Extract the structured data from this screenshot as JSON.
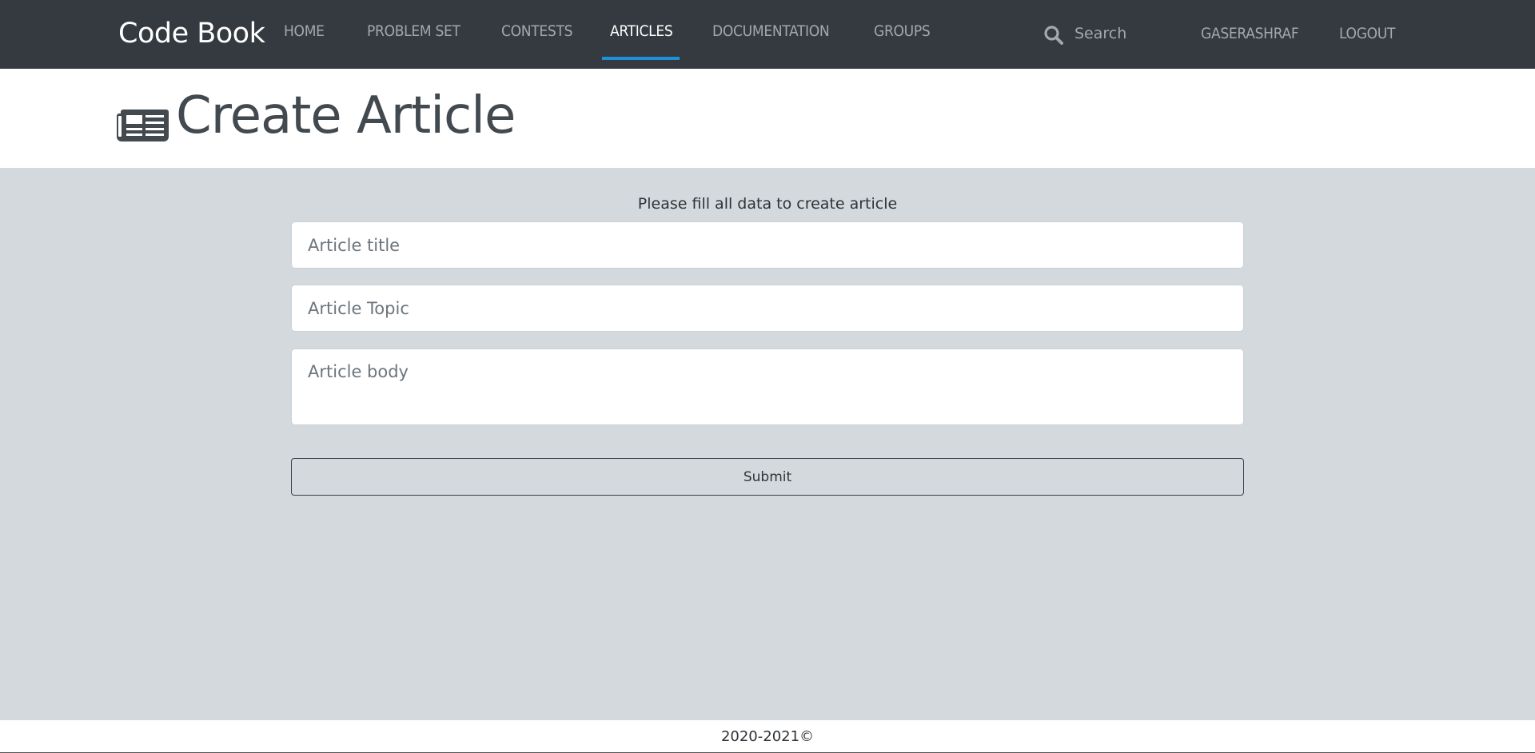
{
  "navbar": {
    "brand": "Code Book",
    "items": [
      {
        "label": "HOME",
        "active": false
      },
      {
        "label": "PROBLEM SET",
        "active": false
      },
      {
        "label": "CONTESTS",
        "active": false
      },
      {
        "label": "ARTICLES",
        "active": true
      },
      {
        "label": "DOCUMENTATION",
        "active": false
      },
      {
        "label": "GROUPS",
        "active": false
      }
    ],
    "search": {
      "placeholder": "Search",
      "icon": "search-icon"
    },
    "user": "GASERASHRAF",
    "logout": "LOGOUT",
    "accent_color": "#1e90d6",
    "background_color": "#343a40"
  },
  "header": {
    "icon": "newspaper-icon",
    "title": "Create Article"
  },
  "form": {
    "hint": "Please fill all data to create article",
    "title_placeholder": "Article title",
    "topic_placeholder": "Article Topic",
    "body_placeholder": "Article body",
    "submit_label": "Submit"
  },
  "footer": {
    "text": "2020-2021©"
  }
}
